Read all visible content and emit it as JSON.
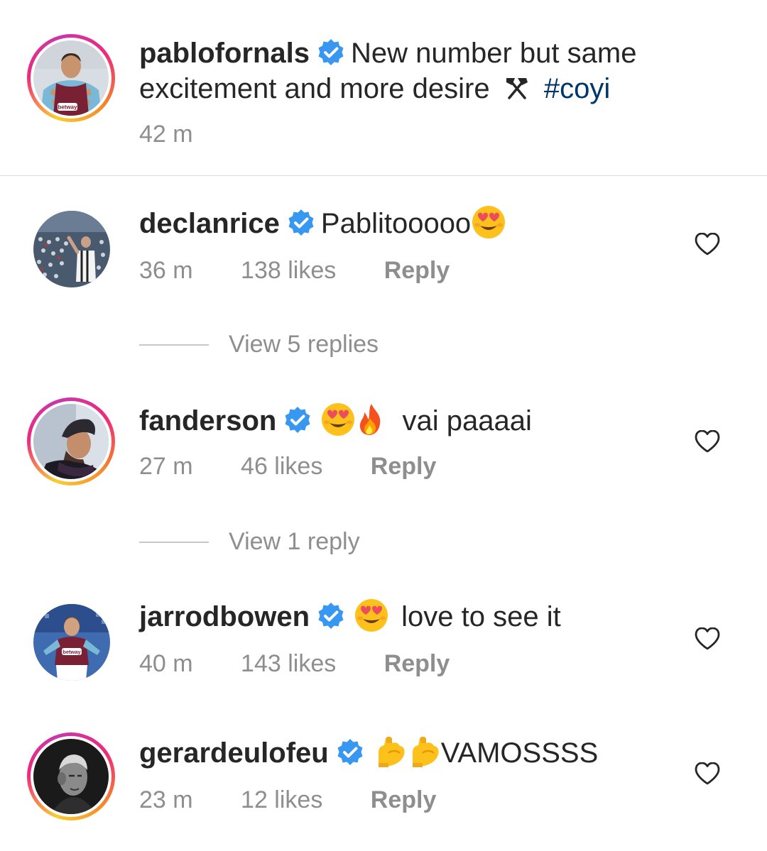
{
  "caption": {
    "username": "pablofornals",
    "text": "New number but same excitement and more desire",
    "emoji": "hammers-icon",
    "hashtag": "#coyi",
    "time": "42 m"
  },
  "comments": [
    {
      "username": "declanrice",
      "text": "Pablitooooo",
      "emojis": [
        "heart-eyes-icon"
      ],
      "time": "36 m",
      "likes": "138 likes",
      "reply_label": "Reply",
      "view_replies": "View 5 replies"
    },
    {
      "username": "fanderson",
      "text": "vai paaaai",
      "emojis": [
        "heart-eyes-icon",
        "fire-icon"
      ],
      "time": "27 m",
      "likes": "46 likes",
      "reply_label": "Reply",
      "view_replies": "View 1 reply"
    },
    {
      "username": "jarrodbowen",
      "text": "love to see it",
      "emojis": [
        "heart-eyes-icon"
      ],
      "time": "40 m",
      "likes": "143 likes",
      "reply_label": "Reply"
    },
    {
      "username": "gerardeulofeu",
      "text": "VAMOSSSS",
      "emojis": [
        "flexed-biceps-icon",
        "flexed-biceps-icon"
      ],
      "time": "23 m",
      "likes": "12 likes",
      "reply_label": "Reply"
    }
  ],
  "colors": {
    "text": "#262626",
    "secondary": "#8e8e8e",
    "hashtag": "#00376b",
    "verified": "#3897f0",
    "divider": "#dbdbdb"
  },
  "avatar_badge_text": "betway"
}
